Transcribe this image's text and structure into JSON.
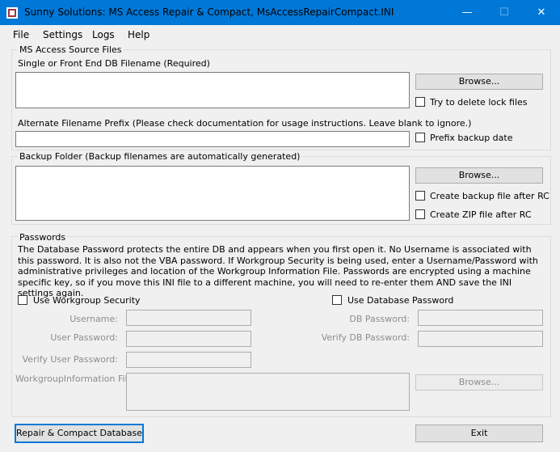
{
  "window": {
    "title": "Sunny Solutions: MS Access Repair & Compact, MsAccessRepairCompact.INI",
    "minimize": "—",
    "maximize": "☐",
    "close": "✕"
  },
  "menu": {
    "file": "File",
    "settings": "Settings",
    "logs": "Logs",
    "help": "Help"
  },
  "source_files": {
    "group_label": "MS Access Source Files",
    "db_label": "Single or Front End DB Filename (Required)",
    "db_value": "",
    "browse": "Browse...",
    "delete_lock_label": "Try to delete lock files",
    "prefix_label": "Alternate Filename Prefix  (Please check documentation for usage instructions. Leave blank to ignore.)",
    "prefix_value": "",
    "prefix_backup_date_label": "Prefix backup date"
  },
  "backup": {
    "group_label": "Backup Folder (Backup filenames are automatically generated)",
    "folder_value": "",
    "browse": "Browse...",
    "create_backup_label": "Create backup file after RC",
    "create_zip_label": "Create ZIP file after RC"
  },
  "passwords": {
    "group_label": "Passwords",
    "description": "The Database Password protects the entire DB and appears when you first open it. No Username is associated with this password. It is also not the VBA password. If Workgroup Security is being used, enter a Username/Password with administrative privileges and location of the Workgroup Information File. Passwords are encrypted using a machine specific key, so if you move this INI file to a different machine, you will need to re-enter them AND save the INI settings again.",
    "use_workgroup_label": "Use Workgroup Security",
    "use_db_password_label": "Use Database Password",
    "username_label": "Username:",
    "user_password_label": "User Password:",
    "verify_user_password_label": "Verify User Password:",
    "workgroup_file_label": "WorkgroupInformation File:",
    "db_password_label": "DB Password:",
    "verify_db_password_label": "Verify DB Password:",
    "browse": "Browse..."
  },
  "actions": {
    "repair": "Repair & Compact Database",
    "exit": "Exit"
  },
  "colors": {
    "titlebar": "#0078d7",
    "background": "#f0f0f0",
    "focus_border": "#0078d7"
  }
}
